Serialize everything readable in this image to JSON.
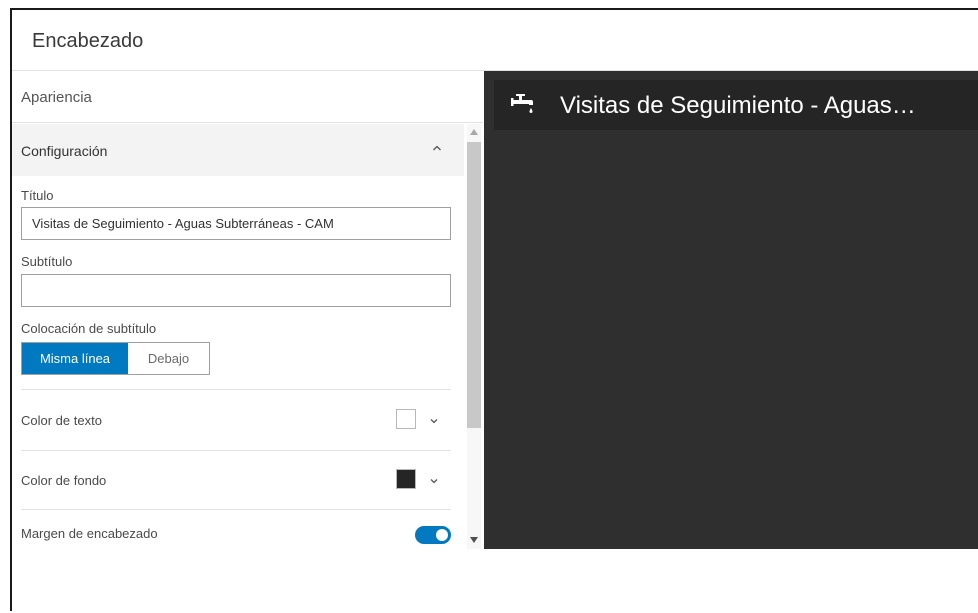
{
  "window": {
    "title": "Encabezado"
  },
  "panel": {
    "tab_label": "Apariencia",
    "section": {
      "label": "Configuración",
      "title_label": "Título",
      "title_value": "Visitas de Seguimiento - Aguas Subterráneas - CAM",
      "subtitle_label": "Subtítulo",
      "subtitle_value": "",
      "placement_label": "Colocación de subtítulo",
      "placement_options": [
        "Misma línea",
        "Debajo"
      ],
      "placement_selected": "Misma línea",
      "text_color_label": "Color de texto",
      "text_color": "#ffffff",
      "background_color_label": "Color de fondo",
      "background_color": "#252525",
      "margin_label": "Margen de encabezado",
      "margin_enabled": true
    }
  },
  "preview": {
    "icon": "faucet-icon",
    "title": "Visitas de Seguimiento - Aguas…"
  },
  "colors": {
    "accent": "#0079c1",
    "preview_bg": "#2f2f2f",
    "header_bg": "#252525"
  }
}
